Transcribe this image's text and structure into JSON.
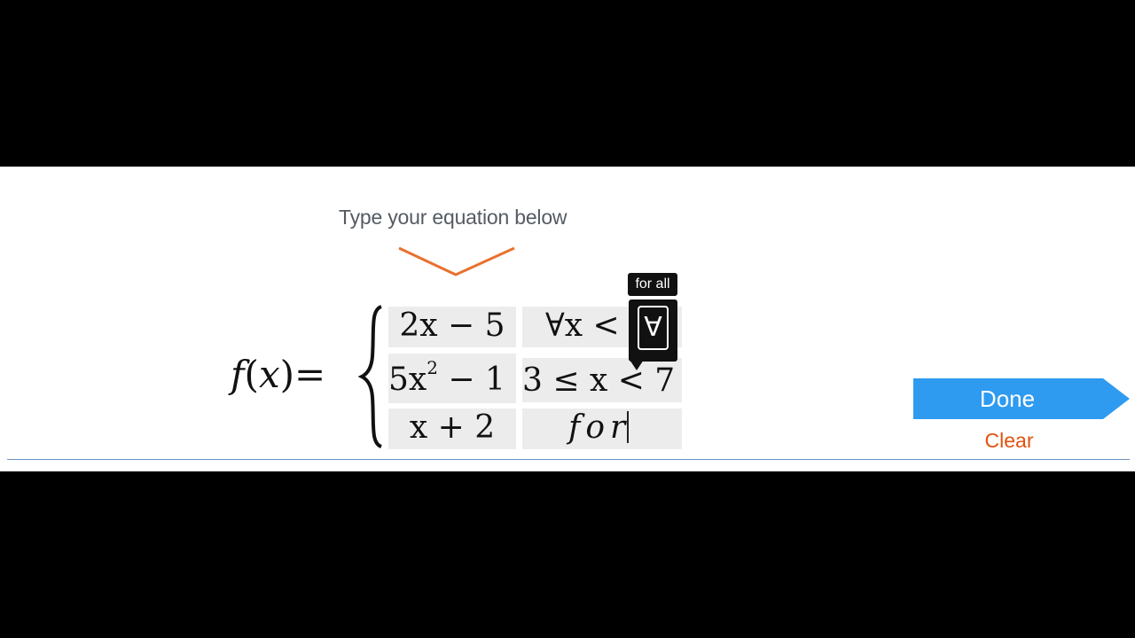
{
  "prompt": "Type your equation below",
  "equation": {
    "lhs_func": "f",
    "lhs_open": "(",
    "lhs_var": "x",
    "lhs_close": ")",
    "equals": "=",
    "rows": [
      {
        "expr": "2x − 5",
        "condition": "∀x <"
      },
      {
        "expr_base": "5x",
        "expr_exp": "2",
        "expr_rest": " − 1",
        "condition": "3 ≤ x < 7"
      },
      {
        "expr": "x + 2",
        "condition": "for"
      }
    ]
  },
  "tooltip": {
    "label": "for all",
    "symbol": "∀"
  },
  "buttons": {
    "done": "Done",
    "clear": "Clear"
  },
  "colors": {
    "done_bg": "#2f9bf0",
    "clear_text": "#e2520f",
    "indicator_arrow": "#e8712e",
    "divider": "#6b94c7"
  }
}
